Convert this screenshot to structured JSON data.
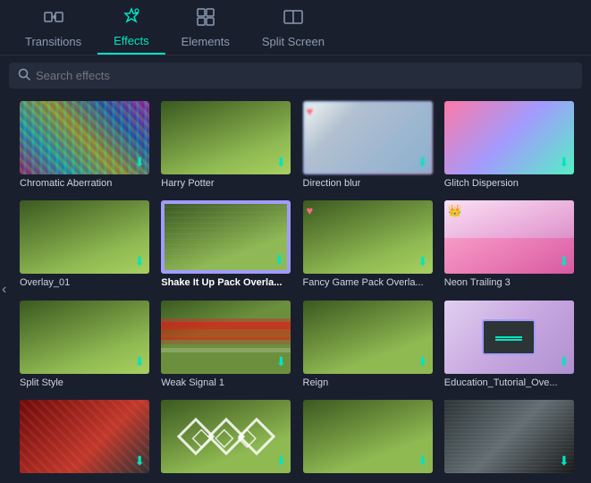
{
  "nav": {
    "items": [
      {
        "id": "transitions",
        "label": "Transitions",
        "icon": "↔",
        "active": false
      },
      {
        "id": "effects",
        "label": "Effects",
        "icon": "✦",
        "active": true
      },
      {
        "id": "elements",
        "label": "Elements",
        "icon": "⊞",
        "active": false
      },
      {
        "id": "split-screen",
        "label": "Split Screen",
        "icon": "⊟",
        "active": false
      }
    ]
  },
  "search": {
    "placeholder": "Search effects"
  },
  "effects": [
    {
      "id": 1,
      "label": "Chromatic Aberration",
      "bold": false,
      "hasDownload": true,
      "hasHeart": false,
      "hasCrown": false,
      "thumbClass": "thumb-chromatic"
    },
    {
      "id": 2,
      "label": "Harry Potter",
      "bold": false,
      "hasDownload": true,
      "hasHeart": false,
      "hasCrown": false,
      "thumbClass": "thumb-vineyard"
    },
    {
      "id": 3,
      "label": "Direction blur",
      "bold": false,
      "hasDownload": true,
      "hasHeart": true,
      "hasCrown": false,
      "thumbClass": "thumb-blur"
    },
    {
      "id": 4,
      "label": "Glitch Dispersion",
      "bold": false,
      "hasDownload": true,
      "hasHeart": false,
      "hasCrown": false,
      "thumbClass": "thumb-glitch"
    },
    {
      "id": 5,
      "label": "Overlay_01",
      "bold": false,
      "hasDownload": true,
      "hasHeart": false,
      "hasCrown": false,
      "thumbClass": "thumb-overlay"
    },
    {
      "id": 6,
      "label": "Shake It Up Pack Overla...",
      "bold": true,
      "hasDownload": true,
      "hasHeart": false,
      "hasCrown": false,
      "thumbClass": "thumb-shake"
    },
    {
      "id": 7,
      "label": "Fancy Game Pack Overla...",
      "bold": false,
      "hasDownload": true,
      "hasHeart": true,
      "hasCrown": false,
      "thumbClass": "thumb-fancy"
    },
    {
      "id": 8,
      "label": "Neon Trailing 3",
      "bold": false,
      "hasDownload": true,
      "hasHeart": false,
      "hasCrown": true,
      "thumbClass": "thumb-neon"
    },
    {
      "id": 9,
      "label": "Split Style",
      "bold": false,
      "hasDownload": true,
      "hasHeart": false,
      "hasCrown": false,
      "thumbClass": "thumb-split"
    },
    {
      "id": 10,
      "label": "Weak Signal 1",
      "bold": false,
      "hasDownload": true,
      "hasHeart": false,
      "hasCrown": false,
      "thumbClass": "thumb-weak"
    },
    {
      "id": 11,
      "label": "Reign",
      "bold": false,
      "hasDownload": true,
      "hasHeart": false,
      "hasCrown": false,
      "thumbClass": "thumb-reign"
    },
    {
      "id": 12,
      "label": "Education_Tutorial_Ove...",
      "bold": false,
      "hasDownload": true,
      "hasHeart": false,
      "hasCrown": false,
      "thumbClass": "thumb-edu"
    },
    {
      "id": 13,
      "label": "",
      "bold": false,
      "hasDownload": true,
      "hasHeart": false,
      "hasCrown": false,
      "thumbClass": "thumb-red"
    },
    {
      "id": 14,
      "label": "",
      "bold": false,
      "hasDownload": true,
      "hasHeart": false,
      "hasCrown": false,
      "thumbClass": "thumb-diamond"
    },
    {
      "id": 15,
      "label": "",
      "bold": false,
      "hasDownload": true,
      "hasHeart": false,
      "hasCrown": false,
      "thumbClass": "thumb-reign"
    },
    {
      "id": 16,
      "label": "",
      "bold": false,
      "hasDownload": true,
      "hasHeart": false,
      "hasCrown": false,
      "thumbClass": "thumb-comic"
    }
  ],
  "arrow": "‹",
  "colors": {
    "accent": "#00e5c0",
    "heart": "#ff6b81",
    "crown": "#f9ca24",
    "bg": "#1a1f2e"
  }
}
